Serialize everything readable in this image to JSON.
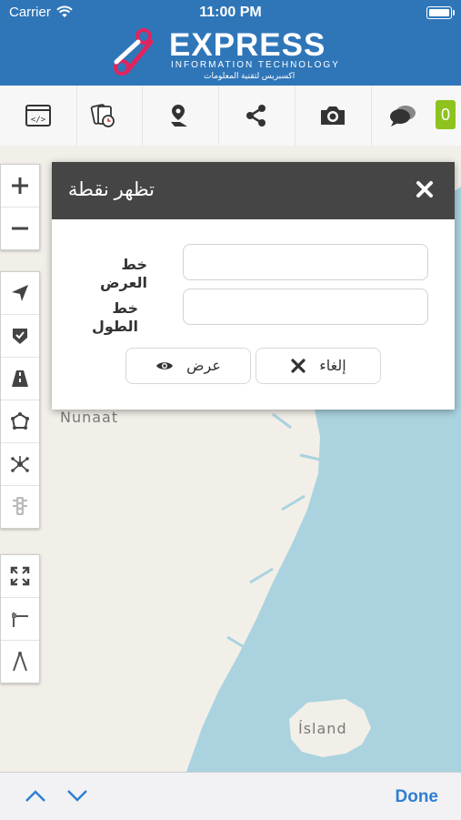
{
  "status": {
    "carrier": "Carrier",
    "time": "11:00 PM"
  },
  "logo": {
    "title": "EXPRESS",
    "subtitle": "INFORMATION TECHNOLOGY",
    "arabic": "اكسبريس لتقنية المعلومات"
  },
  "toolbar": {
    "items": [
      {
        "icon": "embed-code-icon"
      },
      {
        "icon": "history-cards-icon"
      },
      {
        "icon": "location-pin-icon"
      },
      {
        "icon": "share-icon"
      },
      {
        "icon": "camera-icon"
      },
      {
        "icon": "chat-icon"
      }
    ],
    "chat_count": "0"
  },
  "map": {
    "labels": {
      "nunaat": "Nunaat",
      "island": "Ísland"
    }
  },
  "controls": {
    "zoom": [
      "zoom-in-icon",
      "zoom-out-icon"
    ],
    "tools": [
      "navigate-arrow-icon",
      "shield-check-icon",
      "road-icon",
      "polygon-icon",
      "network-icon",
      "traffic-light-icon"
    ],
    "measure": [
      "fullscreen-icon",
      "ruler-icon",
      "compass-angle-icon"
    ]
  },
  "dialog": {
    "title": "تظهر نقطة",
    "latitude_label": "خط العرض",
    "longitude_label": "خط الطول",
    "latitude_value": "",
    "longitude_value": "",
    "show_button": "عرض",
    "cancel_button": "إلغاء"
  },
  "bottom": {
    "done_label": "Done"
  },
  "colors": {
    "header": "#2f76b9",
    "water": "#aad3df",
    "land": "#f2efe9",
    "badge": "#8ec31e",
    "done": "#2e7fd1"
  }
}
